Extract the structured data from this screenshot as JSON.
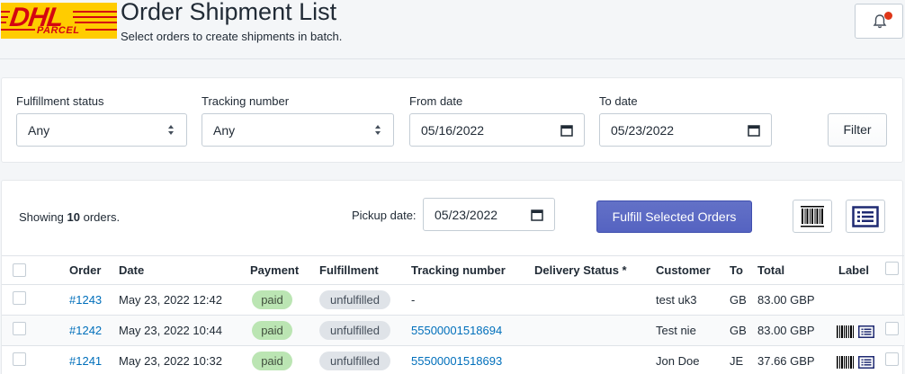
{
  "header": {
    "logo": {
      "brand": "DHL",
      "sub": "PARCEL"
    },
    "title": "Order Shipment List",
    "subtitle": "Select orders to create shipments in batch.",
    "notification_icon": "bell-icon",
    "notification_dot_color": "#de3618"
  },
  "filters": {
    "fulfillment_status": {
      "label": "Fulfillment status",
      "value": "Any"
    },
    "tracking_number": {
      "label": "Tracking number",
      "value": "Any"
    },
    "from_date": {
      "label": "From date",
      "value": "05/16/2022"
    },
    "to_date": {
      "label": "To date",
      "value": "05/23/2022"
    },
    "filter_button": "Filter"
  },
  "orders": {
    "showing_prefix": "Showing",
    "showing_count": "10",
    "showing_suffix": "orders.",
    "pickup_label": "Pickup date:",
    "pickup_value": "05/23/2022",
    "fulfill_button": "Fulfill Selected Orders",
    "accent_color": "#5c6ac4",
    "columns": {
      "order": "Order",
      "date": "Date",
      "payment": "Payment",
      "fulfillment": "Fulfillment",
      "tracking": "Tracking number",
      "delivery": "Delivery Status *",
      "customer": "Customer",
      "to": "To",
      "total": "Total",
      "label": "Label"
    },
    "rows": [
      {
        "order": "#1243",
        "date": "May 23, 2022 12:42",
        "payment": "paid",
        "fulfillment": "unfulfilled",
        "tracking": "-",
        "delivery": "",
        "customer": "test uk3",
        "to": "GB",
        "total": "83.00 GBP"
      },
      {
        "order": "#1242",
        "date": "May 23, 2022 10:44",
        "payment": "paid",
        "fulfillment": "unfulfilled",
        "tracking": "55500001518694",
        "delivery": "",
        "customer": "Test nie",
        "to": "GB",
        "total": "83.00 GBP"
      },
      {
        "order": "#1241",
        "date": "May 23, 2022 10:32",
        "payment": "paid",
        "fulfillment": "unfulfilled",
        "tracking": "55500001518693",
        "delivery": "",
        "customer": "Jon Doe",
        "to": "JE",
        "total": "37.66 GBP"
      }
    ]
  }
}
